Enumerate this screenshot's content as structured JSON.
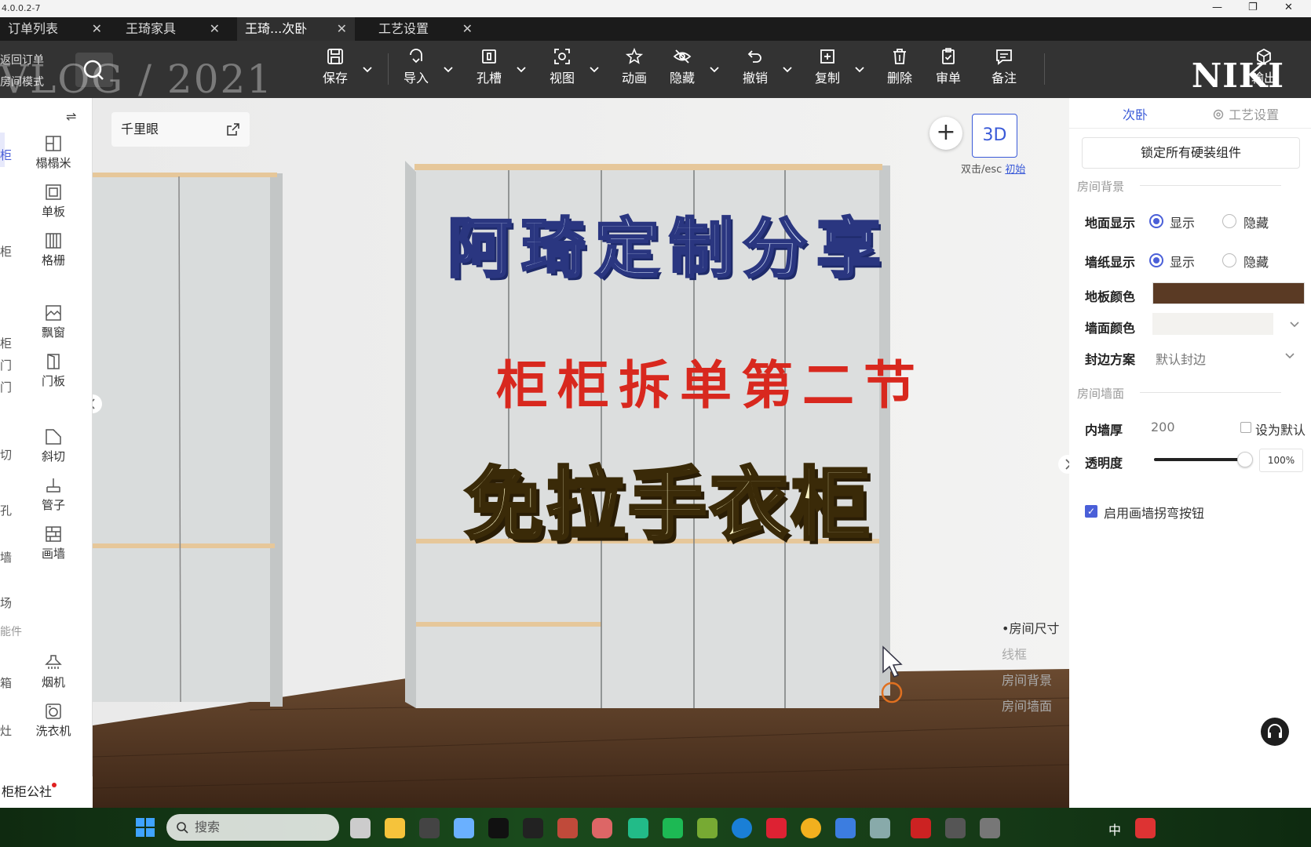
{
  "window": {
    "version": "4.0.0.2-7"
  },
  "tabs": [
    {
      "label": "订单列表",
      "active": false
    },
    {
      "label": "王琦家具",
      "active": false
    },
    {
      "label": "王琦...次卧",
      "active": true
    },
    {
      "label": "工艺设置",
      "active": false
    }
  ],
  "overlay": {
    "watermark": "VLOG / 2021",
    "logo": "NIKI"
  },
  "toolbar": {
    "side_top": "返回订单",
    "side_bottom": "房间模式",
    "items": [
      {
        "label": "保存",
        "icon": "save-icon"
      },
      {
        "label": "导入",
        "icon": "import-icon"
      },
      {
        "label": "孔槽",
        "icon": "hole-slot-icon"
      },
      {
        "label": "视图",
        "icon": "view-icon"
      },
      {
        "label": "动画",
        "icon": "animation-icon"
      },
      {
        "label": "隐藏",
        "icon": "hide-icon"
      },
      {
        "label": "撤销",
        "icon": "undo-icon"
      },
      {
        "label": "复制",
        "icon": "copy-icon"
      },
      {
        "label": "删除",
        "icon": "delete-icon"
      },
      {
        "label": "审单",
        "icon": "review-icon"
      },
      {
        "label": "备注",
        "icon": "note-icon"
      },
      {
        "label": "输出",
        "icon": "output-icon"
      }
    ]
  },
  "left_panel": {
    "stubs": [
      "柜",
      "柜",
      "柜",
      "门",
      "门",
      "切",
      "孔",
      "墙",
      "场",
      "能件",
      "箱",
      "灶"
    ],
    "items": [
      {
        "label": "榻榻米",
        "icon": "tatami-icon"
      },
      {
        "label": "单板",
        "icon": "single-board-icon"
      },
      {
        "label": "格栅",
        "icon": "grille-icon"
      },
      {
        "label": "飘窗",
        "icon": "bay-window-icon"
      },
      {
        "label": "门板",
        "icon": "door-panel-icon"
      },
      {
        "label": "斜切",
        "icon": "bevel-cut-icon"
      },
      {
        "label": "管子",
        "icon": "pipe-icon"
      },
      {
        "label": "画墙",
        "icon": "draw-wall-icon"
      },
      {
        "label": "烟机",
        "icon": "range-hood-icon"
      },
      {
        "label": "洗衣机",
        "icon": "washing-machine-icon"
      }
    ],
    "bottom_label": "柜柜公社"
  },
  "viewport": {
    "qianliyan": "千里眼",
    "mode_3d": "3D",
    "hint": "双击/esc",
    "hint_link": "初始",
    "layers": [
      "•房间尺寸",
      "线框",
      "房间背景",
      "房间墙面"
    ],
    "title_main": "阿琦定制分享",
    "title_sub": "柜柜拆单第二节",
    "title_big": "免拉手衣柜"
  },
  "right_panel": {
    "tab_room": "次卧",
    "tab_settings": "工艺设置",
    "lock_button": "锁定所有硬装组件",
    "section_bg": "房间背景",
    "floor_display": {
      "label": "地面显示",
      "show": "显示",
      "hide": "隐藏",
      "selected": "显示"
    },
    "wallpaper_display": {
      "label": "墙纸显示",
      "show": "显示",
      "hide": "隐藏",
      "selected": "显示"
    },
    "floor_color": {
      "label": "地板颜色",
      "color": "#5a3a24"
    },
    "wall_color": {
      "label": "墙面颜色",
      "color": "#f3f2ef"
    },
    "edge_scheme": {
      "label": "封边方案",
      "value": "默认封边"
    },
    "section_wall": "房间墙面",
    "inner_wall": {
      "label": "内墙厚",
      "value": "200",
      "default_label": "设为默认"
    },
    "opacity": {
      "label": "透明度",
      "value": "100%",
      "fraction": 1.0
    },
    "enable_bend": {
      "label": "启用画墙拐弯按钮",
      "checked": true
    }
  },
  "taskbar": {
    "search_placeholder": "搜索",
    "ime": "中"
  },
  "colors": {
    "accent": "#3a5ad8",
    "toolbar_bg": "#333333",
    "tabbar_bg": "#1b1b1b"
  }
}
